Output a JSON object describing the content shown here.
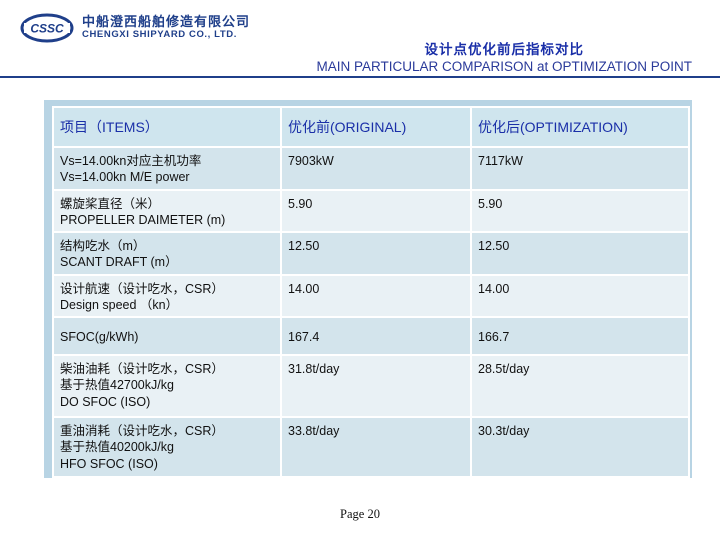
{
  "logo": {
    "mark_text": "CSSC",
    "company_cn": "中船澄西船舶修造有限公司",
    "company_en": "CHENGXI SHIPYARD CO., LTD.",
    "brand_color": "#1f3f8a"
  },
  "title": {
    "cn": "设计点优化前后指标对比",
    "en": "MAIN PARTICULAR COMPARISON at OPTIMIZATION POINT"
  },
  "table": {
    "headers": [
      "项目（ITEMS）",
      "优化前(ORIGINAL)",
      "优化后(OPTIMIZATION)"
    ],
    "rows": [
      {
        "item": "Vs=14.00kn对应主机功率\nVs=14.00kn M/E power",
        "original": "7903kW",
        "optimization": "7117kW"
      },
      {
        "item": "螺旋桨直径（米）\nPROPELLER DAIMETER (m)",
        "original": "5.90",
        "optimization": "5.90"
      },
      {
        "item": "结构吃水（m）\nSCANT DRAFT (m）",
        "original": "12.50",
        "optimization": "12.50"
      },
      {
        "item": "设计航速（设计吃水，CSR）\nDesign speed （kn）",
        "original": "14.00",
        "optimization": "14.00"
      },
      {
        "item": "SFOC(g/kWh)",
        "original": "167.4",
        "optimization": "166.7"
      },
      {
        "item": "柴油油耗（设计吃水，CSR）\n基于热值42700kJ/kg\n DO SFOC (ISO)",
        "original": "31.8t/day",
        "optimization": "28.5t/day"
      },
      {
        "item": "重油消耗（设计吃水，CSR）\n基于热值40200kJ/kg\nHFO SFOC (ISO)",
        "original": "33.8t/day",
        "optimization": "30.3t/day"
      }
    ]
  },
  "footer": {
    "page": "Page 20"
  }
}
